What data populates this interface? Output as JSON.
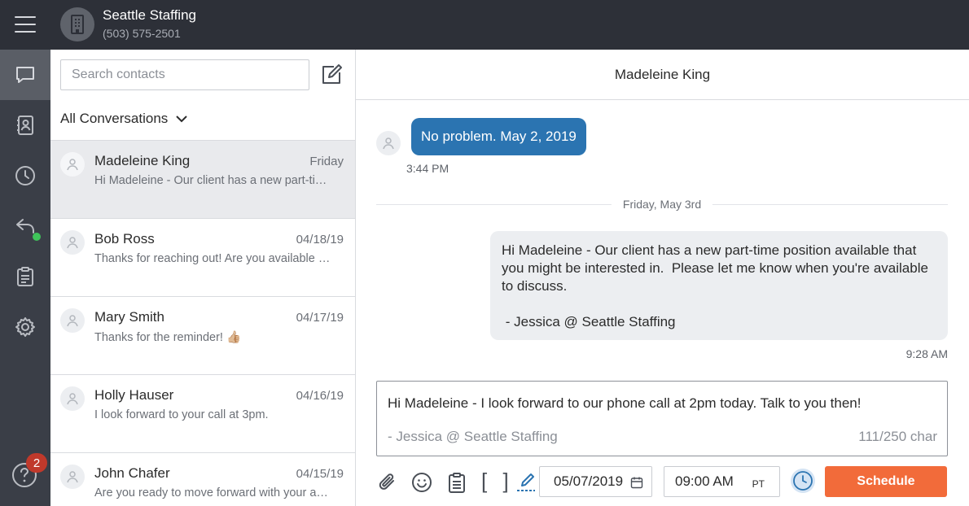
{
  "org": {
    "name": "Seattle Staffing",
    "phone": "(503) 575-2501"
  },
  "rail": {
    "icons": [
      "messages-icon",
      "contacts-icon",
      "history-icon",
      "reply-icon",
      "clipboard-icon",
      "settings-icon",
      "help-icon"
    ],
    "help_badge": "2",
    "active_color": "#5a5e66",
    "status_color": "#3fc35a"
  },
  "sidebar": {
    "search_placeholder": "Search contacts",
    "filter_label": "All Conversations",
    "conversations": [
      {
        "name": "Madeleine King",
        "date": "Friday",
        "preview": "Hi Madeleine - Our client has a new part-time position available that you might be interested in."
      },
      {
        "name": "Bob Ross",
        "date": "04/18/19",
        "preview": "Thanks for reaching out! Are you available to talk tomorrow?"
      },
      {
        "name": "Mary Smith",
        "date": "04/17/19",
        "preview": "Thanks for the reminder! 👍🏼"
      },
      {
        "name": "Holly Hauser",
        "date": "04/16/19",
        "preview": "I look forward to your call at 3pm."
      },
      {
        "name": "John Chafer",
        "date": "04/15/19",
        "preview": "Are you ready to move forward with your application?"
      }
    ]
  },
  "chat": {
    "contact_name": "Madeleine King",
    "incoming": {
      "text": "No problem. May 2, 2019",
      "time": "3:44 PM",
      "color": "#2b74b1"
    },
    "day_separator": "Friday, May 3rd",
    "outgoing": {
      "text": "Hi Madeleine - Our client has a new part-time position available that you might be interested in.  Please let me know when you're available to discuss.\n\n - Jessica @ Seattle Staffing",
      "time": "9:28 AM"
    },
    "composer": {
      "text": "Hi Madeleine - I look forward to our phone call at 2pm today.  Talk to you then!",
      "signature": "- Jessica @ Seattle Staffing",
      "char_count": "111/250 char"
    },
    "toolbar": {
      "brackets": "[ ]",
      "date": "05/07/2019",
      "time": "09:00 AM",
      "timezone": "PT",
      "schedule_label": "Schedule",
      "schedule_color": "#f26b3a"
    }
  }
}
